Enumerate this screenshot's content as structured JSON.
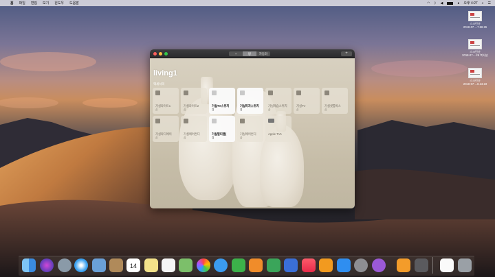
{
  "menubar": {
    "apple_glyph": "",
    "menus": [
      "홈",
      "파일",
      "편집",
      "보기",
      "윈도우",
      "도움말"
    ],
    "clock": "오후 4:27",
    "status_icons": [
      "wifi-icon",
      "bluetooth-icon",
      "volume-icon",
      "battery-icon",
      "user-icon",
      "search-icon",
      "notifications-icon"
    ]
  },
  "desktop": {
    "files": [
      {
        "name": "스크린샷",
        "date": "2018-07-...7.58.26"
      },
      {
        "name": "스크린샷",
        "date": "2018-07-...26 복사본"
      },
      {
        "name": "스크린샷",
        "date": "2018-07-...8.13.23"
      }
    ]
  },
  "window": {
    "tabs": [
      "",
      "방",
      "자동화"
    ],
    "selected_tab": "방",
    "add_label": "+",
    "room_title": "living1",
    "section_label": "액세서리",
    "accessories": [
      {
        "name": "거실라이트1",
        "status": "끔",
        "on": false
      },
      {
        "name": "거실라이트2",
        "status": "끔",
        "on": false
      },
      {
        "name": "거실TV스위치",
        "status": "켬",
        "on": true
      },
      {
        "name": "거실피자스위치",
        "status": "켬",
        "on": true
      },
      {
        "name": "거실제습스위치",
        "status": "끔",
        "on": false
      },
      {
        "name": "거실TV",
        "status": "끔",
        "on": false
      },
      {
        "name": "거실셋톱박스",
        "status": "끔",
        "on": false
      },
      {
        "name": "거실라디에이",
        "status": "끔",
        "on": false
      },
      {
        "name": "거실에어컨디",
        "status": "끔",
        "on": false
      },
      {
        "name": "거실멀티탭(",
        "status": "켬",
        "on": true
      },
      {
        "name": "거실에어컨디",
        "status": "끔",
        "on": false
      },
      {
        "name": "Apple TV1",
        "status": "",
        "on": false
      }
    ]
  },
  "dock": {
    "apps": [
      "finder-icon",
      "siri-icon",
      "launchpad-icon",
      "safari-icon",
      "mail-icon",
      "contacts-icon",
      "calendar-icon",
      "notes-icon",
      "reminders-icon",
      "maps-icon",
      "photos-icon",
      "messages-icon",
      "facetime-icon",
      "pages-icon",
      "numbers-icon",
      "keynote-icon",
      "music-icon",
      "books-icon",
      "app-store-icon",
      "system-preferences-icon",
      "feedback-icon",
      "home-icon",
      "scripteditor-icon",
      "document-icon",
      "trash-icon"
    ],
    "calendar_day": "14"
  }
}
